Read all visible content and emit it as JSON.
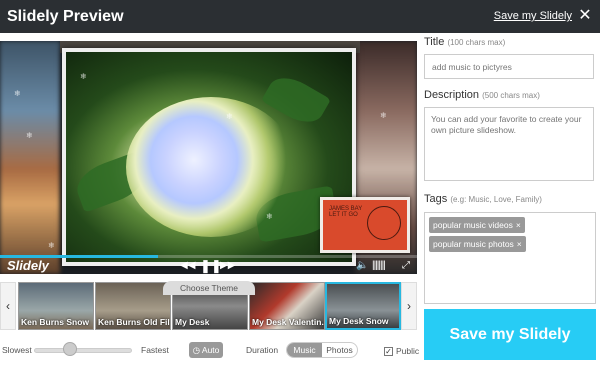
{
  "window": {
    "title": "Slidely Preview",
    "save_link": "Save my Slidely",
    "close_icon": "close-icon"
  },
  "player": {
    "brand": "Slidely",
    "card_text_line1": "JAMES BAY",
    "card_text_line2": "LET IT GO",
    "progress": 0.38,
    "icons": {
      "rewind": "rewind-icon",
      "pause": "pause-icon",
      "forward": "fast-forward-icon",
      "volume": "volume-icon",
      "fullscreen": "fullscreen-icon"
    }
  },
  "themes": {
    "header": "Choose Theme",
    "items": [
      {
        "label": "Ken Burns Snow",
        "selected": false
      },
      {
        "label": "Ken Burns Old Film",
        "selected": false
      },
      {
        "label": "My Desk",
        "selected": false
      },
      {
        "label": "My Desk Valentin...",
        "selected": false
      },
      {
        "label": "My Desk Snow",
        "selected": true
      }
    ]
  },
  "settings": {
    "speed_slowest": "Slowest",
    "speed_fastest": "Fastest",
    "speed_value": 0.32,
    "auto_label": "Auto",
    "duration_label": "Duration",
    "duration_options": [
      "Music",
      "Photos"
    ],
    "duration_selected": "Music",
    "public_label": "Public",
    "public_checked": true
  },
  "form": {
    "title_label": "Title",
    "title_hint": "(100 chars max)",
    "title_placeholder": "add music to pictyres",
    "description_label": "Description",
    "description_hint": "(500 chars max)",
    "description_placeholder": "You can add your favorite to create your own picture slideshow.",
    "tags_label": "Tags",
    "tags_hint": "(e.g: Music, Love, Family)",
    "tags": [
      "popular music videos",
      "popular music photos"
    ],
    "save_button": "Save my Slidely"
  },
  "colors": {
    "accent": "#27ccf5",
    "titlebar": "#2b2f33"
  }
}
